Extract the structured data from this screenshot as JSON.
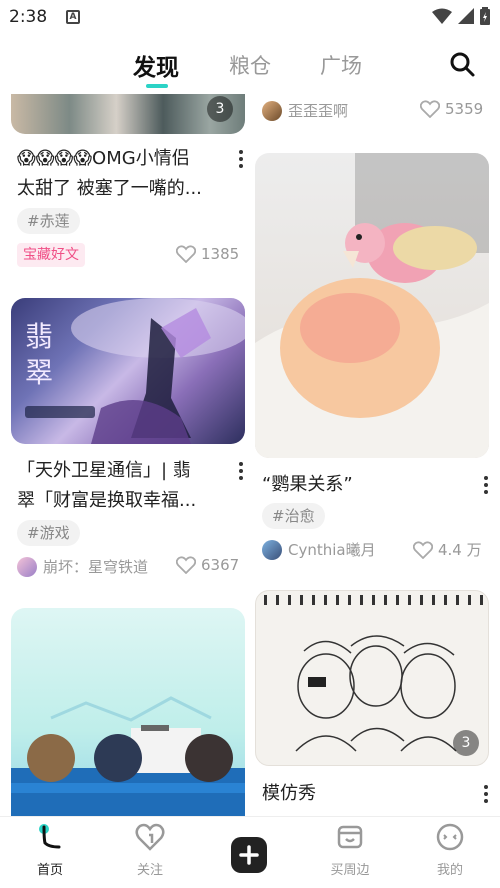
{
  "status_bar": {
    "time": "2:38",
    "notification_icon": "a-icon"
  },
  "top_nav": {
    "tabs": [
      {
        "label": "发现",
        "active": true
      },
      {
        "label": "粮仓",
        "active": false
      },
      {
        "label": "广场",
        "active": false
      }
    ],
    "search_icon": "search-icon",
    "accent_color": "#2bd3c6"
  },
  "feed": {
    "left": [
      {
        "image_count": "3"
      },
      {
        "title_line1": "😱😱😱😱OMG小情侣",
        "title_line2": "太甜了 被塞了一嘴的...",
        "tag": "#赤莲",
        "badge": "宝藏好文",
        "likes": "1385"
      },
      {
        "title_line1": "「天外卫星通信」| 翡",
        "title_line2": "翠「财富是换取幸福...",
        "tag": "#游戏",
        "author": "崩坏：星穹铁道",
        "likes": "6367"
      }
    ],
    "right": [
      {
        "author": "歪歪歪啊",
        "likes": "5359"
      },
      {
        "title": "“鹦果关系”",
        "tag": "#治愈",
        "author": "Cynthia曦月",
        "likes": "4.4 万"
      },
      {
        "title": "模仿秀",
        "image_count": "3"
      }
    ]
  },
  "bottom_nav": {
    "items": [
      {
        "label": "首页",
        "icon": "home-icon",
        "active": true
      },
      {
        "label": "关注",
        "icon": "heart-icon",
        "active": false
      },
      {
        "label": "",
        "icon": "plus-icon",
        "active": false
      },
      {
        "label": "买周边",
        "icon": "shop-icon",
        "active": false
      },
      {
        "label": "我的",
        "icon": "face-icon",
        "active": false
      }
    ]
  }
}
